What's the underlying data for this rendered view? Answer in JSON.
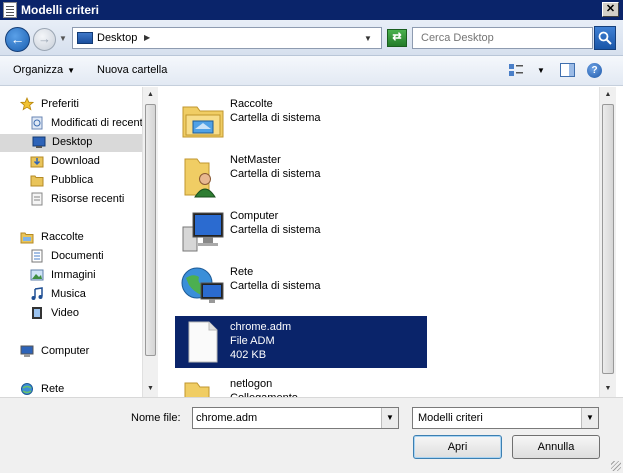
{
  "window": {
    "title": "Modelli criteri",
    "close_label": "✕"
  },
  "address_bar": {
    "location": "Desktop",
    "search_placeholder": "Cerca Desktop"
  },
  "toolbar": {
    "organize_label": "Organizza",
    "new_folder_label": "Nuova cartella",
    "help_label": "?"
  },
  "nav_pane": {
    "items": [
      {
        "label": "Preferiti",
        "icon": "star-icon"
      },
      {
        "label": "Modificati di recente",
        "icon": "recent-places-icon"
      },
      {
        "label": "Desktop",
        "icon": "desktop-icon",
        "selected": true
      },
      {
        "label": "Download",
        "icon": "downloads-folder-icon"
      },
      {
        "label": "Pubblica",
        "icon": "folder-icon"
      },
      {
        "label": "Risorse recenti",
        "icon": "recent-items-icon"
      },
      {
        "label": "Raccolte",
        "icon": "libraries-icon"
      },
      {
        "label": "Documenti",
        "icon": "documents-icon"
      },
      {
        "label": "Immagini",
        "icon": "pictures-icon"
      },
      {
        "label": "Musica",
        "icon": "music-icon"
      },
      {
        "label": "Video",
        "icon": "video-icon"
      },
      {
        "label": "Computer",
        "icon": "computer-icon"
      },
      {
        "label": "Rete",
        "icon": "network-icon"
      }
    ]
  },
  "files": [
    {
      "name": "Raccolte",
      "type": "Cartella di sistema",
      "icon": "libraries-folder-icon"
    },
    {
      "name": "NetMaster",
      "type": "Cartella di sistema",
      "icon": "user-folder-icon"
    },
    {
      "name": "Computer",
      "type": "Cartella di sistema",
      "icon": "computer-icon"
    },
    {
      "name": "Rete",
      "type": "Cartella di sistema",
      "icon": "network-globe-icon"
    },
    {
      "name": "chrome.adm",
      "type": "File ADM",
      "size": "402 KB",
      "icon": "document-file-icon",
      "selected": true
    },
    {
      "name": "netlogon",
      "type": "Collegamento",
      "icon": "folder-shortcut-icon"
    }
  ],
  "footer": {
    "filename_label": "Nome file:",
    "filename_value": "chrome.adm",
    "filetype_value": "Modelli criteri",
    "open_label": "Apri",
    "cancel_label": "Annulla"
  },
  "colors": {
    "title_bar": "#0a246a",
    "selection": "#0a246a",
    "nav_selected": "#d9d9d9"
  }
}
